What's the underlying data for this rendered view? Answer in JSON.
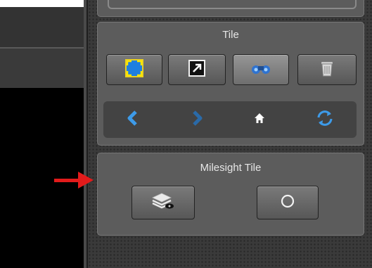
{
  "tile_panel": {
    "title": "Tile",
    "buttons": [
      {
        "icon": "fit-to-frame-icon"
      },
      {
        "icon": "popout-icon"
      },
      {
        "icon": "binoculars-icon",
        "active": true
      },
      {
        "icon": "trash-bin-icon"
      }
    ],
    "nav": [
      {
        "icon": "chevron-left-icon",
        "color": "#3d9be9"
      },
      {
        "icon": "chevron-right-icon",
        "color": "#2a6aa8"
      },
      {
        "icon": "home-icon",
        "color": "#ffffff"
      },
      {
        "icon": "refresh-icon",
        "color": "#3d9be9"
      }
    ]
  },
  "milesight_panel": {
    "title": "Milesight Tile",
    "buttons": [
      {
        "icon": "layers-view-icon"
      },
      {
        "icon": "circle-icon"
      }
    ]
  },
  "annotation": {
    "color": "#e21b1b",
    "icon": "red-arrow-icon"
  }
}
